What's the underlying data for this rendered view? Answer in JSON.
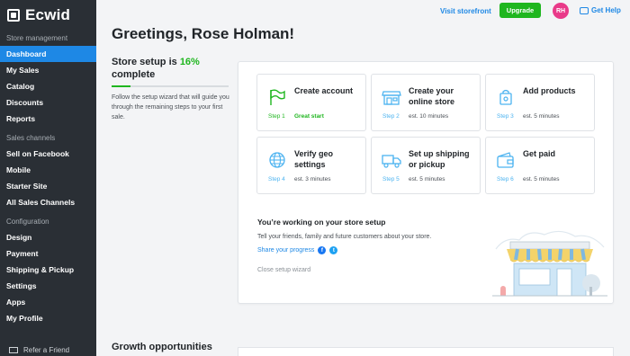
{
  "app": {
    "name": "Ecwid"
  },
  "sidebar": {
    "sections": [
      {
        "title": "Store management",
        "items": [
          "Dashboard",
          "My Sales",
          "Catalog",
          "Discounts",
          "Reports"
        ]
      },
      {
        "title": "Sales channels",
        "items": [
          "Sell on Facebook",
          "Mobile",
          "Starter Site",
          "All Sales Channels"
        ]
      },
      {
        "title": "Configuration",
        "items": [
          "Design",
          "Payment",
          "Shipping & Pickup",
          "Settings",
          "Apps",
          "My Profile"
        ]
      }
    ],
    "active": "Dashboard",
    "footer": "Refer a Friend"
  },
  "topbar": {
    "visit_storefront": "Visit storefront",
    "upgrade": "Upgrade",
    "avatar_initials": "RH",
    "help": "Get Help"
  },
  "page": {
    "title": "Greetings, Rose Holman!"
  },
  "setup": {
    "title_prefix": "Store setup is",
    "percent": "16%",
    "title_suffix": "complete",
    "progress": 0.16,
    "description": "Follow the setup wizard that will guide you through the remaining steps to your first sale."
  },
  "tasks": [
    {
      "title": "Create account",
      "step": "Step 1",
      "estimate": "Great start",
      "done": true,
      "icon": "flag-icon"
    },
    {
      "title": "Create your online store",
      "step": "Step 2",
      "estimate": "est. 10 minutes",
      "icon": "storefront-icon"
    },
    {
      "title": "Add products",
      "step": "Step 3",
      "estimate": "est. 5 minutes",
      "icon": "shopping-bag-icon"
    },
    {
      "title": "Verify geo settings",
      "step": "Step 4",
      "estimate": "est. 3 minutes",
      "icon": "globe-icon"
    },
    {
      "title": "Set up shipping or pickup",
      "step": "Step 5",
      "estimate": "est. 5 minutes",
      "icon": "truck-icon"
    },
    {
      "title": "Get paid",
      "step": "Step 6",
      "estimate": "est. 5 minutes",
      "icon": "wallet-icon"
    }
  ],
  "working": {
    "title": "You’re working on your store setup",
    "description": "Tell your friends, family and future customers about your store.",
    "share": "Share your progress",
    "close": "Close setup wizard"
  },
  "growth": {
    "title": "Growth opportunities"
  },
  "colors": {
    "sidebar_bg": "#2a2f35",
    "accent": "#1e88e5",
    "green": "#1fb61f",
    "avatar": "#e93a89"
  }
}
